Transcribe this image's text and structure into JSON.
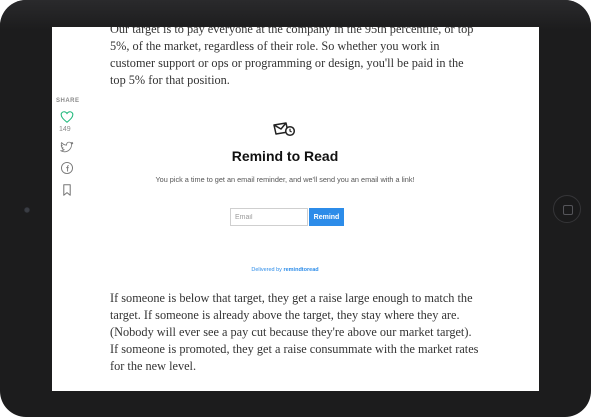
{
  "article": {
    "paragraph_1": "Our target is to pay everyone at the company in the 95th percentile, or top 5%, of the market, regardless of their role. So whether you work in customer support or ops or programming or design, you'll be paid in the top 5% for that position.",
    "paragraph_2": "If someone is below that target, they get a raise large enough to match the target. If someone is already above the target, they stay where they are. (Nobody will ever see a pay cut because they're above our market target). If someone is promoted, they get a raise consummate with the market rates for the new level."
  },
  "share": {
    "label": "SHARE",
    "like_count": "149",
    "icons": [
      "heart-icon",
      "twitter-icon",
      "facebook-icon",
      "bookmark-icon"
    ],
    "like_color": "#1fb87b"
  },
  "remind": {
    "title": "Remind to Read",
    "description": "You pick a time to get an email reminder, and we'll send you an email with a link!",
    "email_placeholder": "Email",
    "button_label": "Remind",
    "delivered_prefix": "Delivered by",
    "delivered_brand": "remindtoread",
    "accent_color": "#2c8ce9"
  }
}
